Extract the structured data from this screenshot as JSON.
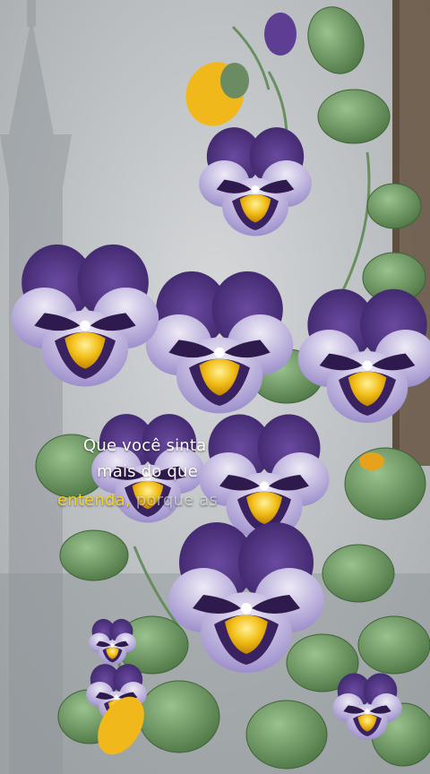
{
  "caption": {
    "line1": "Que você sinta",
    "line2": "mais do que",
    "line3_highlight": "entenda,",
    "line3_rest": " porque as"
  },
  "colors": {
    "sky": "#c8cbce",
    "petal_light": "#cbc2e6",
    "petal_dark": "#5a3a8e",
    "petal_deep": "#3f2460",
    "eye_yellow": "#f2c01a",
    "leaf": "#6f9a67",
    "leaf_dark": "#4f7a4c",
    "highlight_text": "#f6d21b"
  }
}
